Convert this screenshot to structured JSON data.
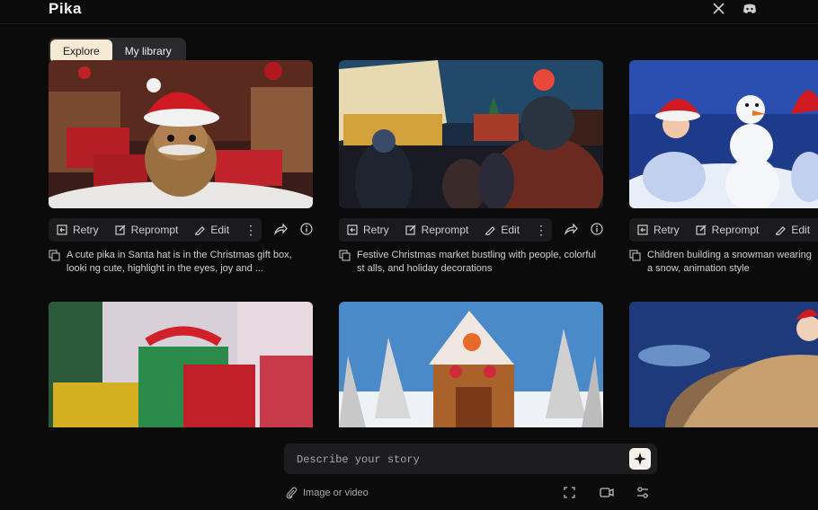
{
  "app": {
    "logo": "Pika"
  },
  "tabs": [
    {
      "label": "Explore",
      "active": true
    },
    {
      "label": "My library",
      "active": false
    }
  ],
  "actions": {
    "retry": "Retry",
    "reprompt": "Reprompt",
    "edit": "Edit"
  },
  "cards": [
    {
      "caption": "A cute pika in Santa hat is in the Christmas gift box, looki ng cute, highlight in the eyes, joy and ..."
    },
    {
      "caption": "Festive Christmas market bustling with people, colorful st alls, and holiday decorations"
    },
    {
      "caption": "Children building a snowman wearing a snow, animation style"
    }
  ],
  "composer": {
    "placeholder": "Describe your story",
    "attach_label": "Image or video"
  },
  "icons": [
    "x-icon",
    "discord-icon",
    "retry-icon",
    "reprompt-icon",
    "edit-icon",
    "more-icon",
    "share-icon",
    "info-icon",
    "copy-icon",
    "sparkle-icon",
    "paperclip-icon",
    "expand-icon",
    "video-camera-icon",
    "settings-sliders-icon"
  ],
  "colors": {
    "background": "#0b0b0c",
    "active_tab": "#f6ead4",
    "panel": "#1b1b1d"
  }
}
